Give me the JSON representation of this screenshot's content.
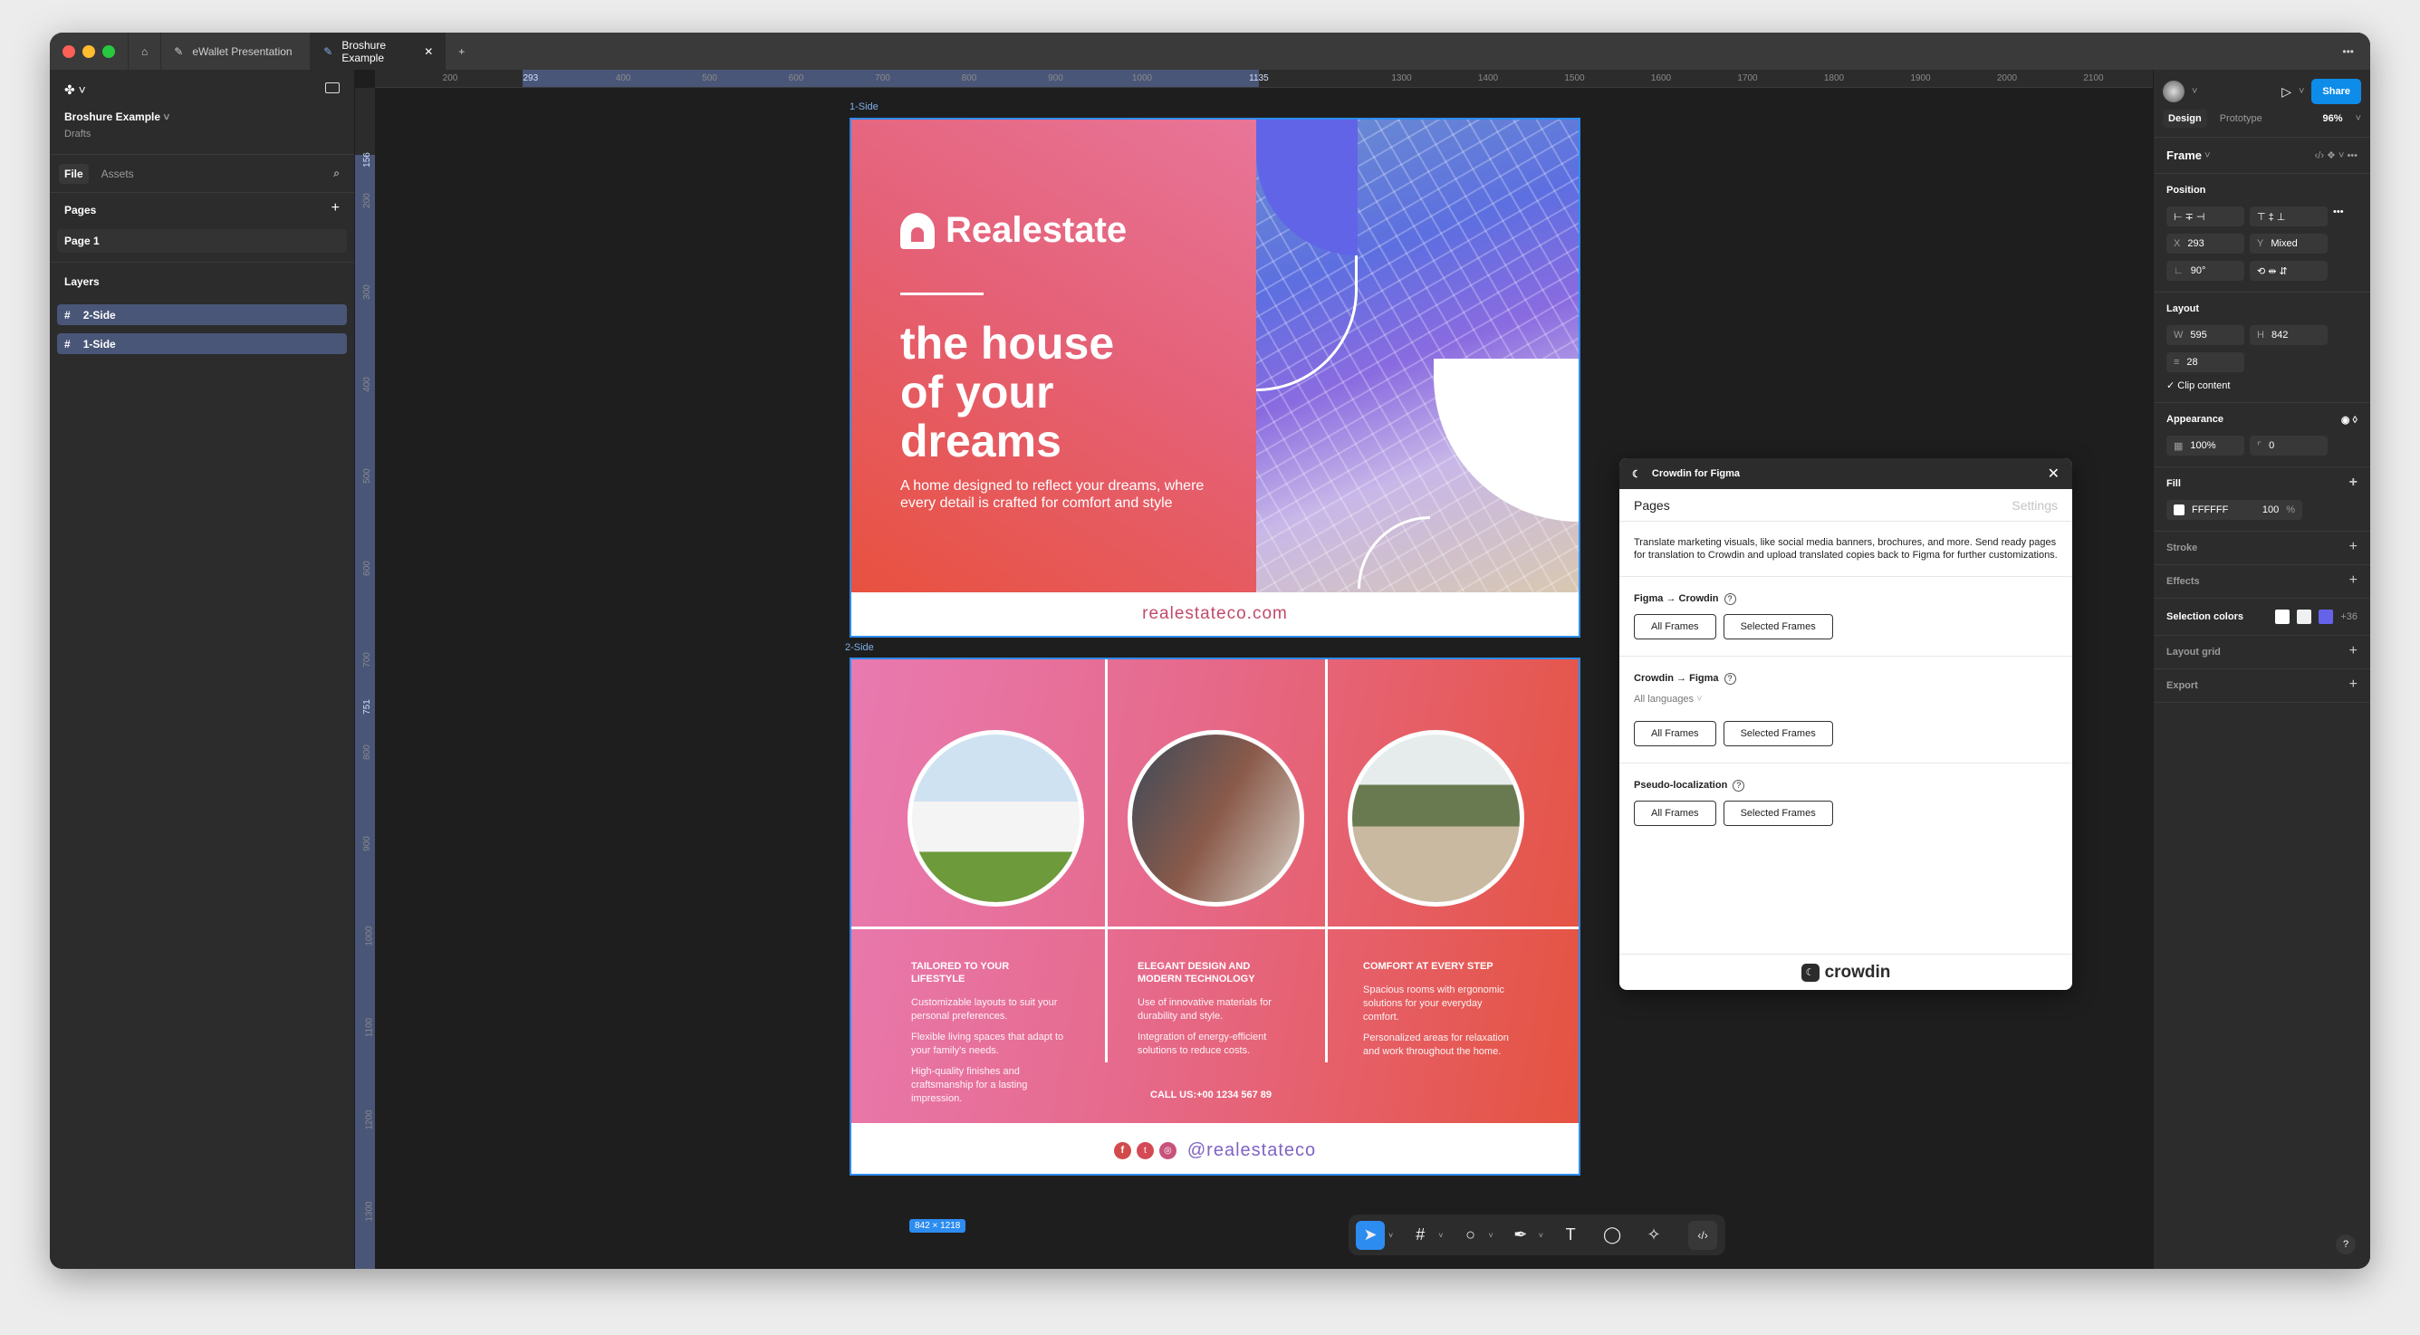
{
  "tabs": [
    {
      "label": "eWallet Presentation"
    },
    {
      "label": "Broshure Example"
    }
  ],
  "left": {
    "file_name": "Broshure Example",
    "location": "Drafts",
    "tab_file": "File",
    "tab_assets": "Assets",
    "pages_title": "Pages",
    "pages": [
      "Page 1"
    ],
    "layers_title": "Layers",
    "layers": [
      "2-Side",
      "1-Side"
    ]
  },
  "rulers": {
    "top": [
      "200",
      "293",
      "400",
      "500",
      "600",
      "700",
      "800",
      "900",
      "1000",
      "1135",
      "1300",
      "1400",
      "1500",
      "1600",
      "1700",
      "1800",
      "1900",
      "2000",
      "2100"
    ],
    "left": [
      "156",
      "200",
      "300",
      "400",
      "500",
      "600",
      "700",
      "751",
      "800",
      "900",
      "1000",
      "1100",
      "1200",
      "1300",
      "1374"
    ]
  },
  "right": {
    "share": "Share",
    "tab_design": "Design",
    "tab_prototype": "Prototype",
    "zoom": "96%",
    "frame": "Frame",
    "position": "Position",
    "x_label": "X",
    "x": "293",
    "y_label": "Y",
    "y": "Mixed",
    "rotation": "90°",
    "layout": "Layout",
    "w_label": "W",
    "w": "595",
    "h_label": "H",
    "h": "842",
    "gap": "28",
    "clip": "Clip content",
    "appearance": "Appearance",
    "opacity": "100%",
    "radius": "0",
    "fill": "Fill",
    "fill_hex": "FFFFFF",
    "fill_opacity": "100",
    "fill_pct": "%",
    "stroke": "Stroke",
    "effects": "Effects",
    "selection_colors": "Selection colors",
    "selection_swatches": [
      "#ffffff",
      "#eef0f2",
      "#6563e8"
    ],
    "selection_more": "+36",
    "layout_grid": "Layout grid",
    "export": "Export"
  },
  "canvas": {
    "frame1_label": "1-Side",
    "frame2_label": "2-Side",
    "size_badge": "842 × 1218"
  },
  "brochure": {
    "brand": "Realestate",
    "headline": [
      "the house",
      "of your",
      "dreams"
    ],
    "subtitle": "A home designed to reflect your dreams, where every detail is crafted for comfort and style",
    "website": "realestateco.com",
    "columns": [
      {
        "title": "TAILORED TO YOUR LIFESTYLE",
        "items": [
          "Customizable layouts to suit your personal preferences.",
          "Flexible living spaces that adapt to your family's needs.",
          "High-quality finishes and craftsmanship for a lasting impression."
        ]
      },
      {
        "title": "ELEGANT DESIGN AND MODERN TECHNOLOGY",
        "items": [
          "Use of innovative materials for durability and style.",
          "Integration of energy-efficient solutions to reduce costs."
        ]
      },
      {
        "title": "COMFORT AT EVERY STEP",
        "items": [
          "Spacious rooms with ergonomic solutions for your everyday comfort.",
          "Personalized areas for relaxation and work throughout the home."
        ]
      }
    ],
    "call": "CALL US:+00 1234 567 89",
    "handle": "@realestateco"
  },
  "plugin": {
    "title": "Crowdin for Figma",
    "tab_pages": "Pages",
    "tab_settings": "Settings",
    "description": "Translate marketing visuals, like social media banners, brochures, and more. Send ready pages for translation to Crowdin and upload translated copies back to Figma for further customizations.",
    "sections": [
      {
        "title": "Figma → Crowdin",
        "all": "All Frames",
        "selected": "Selected Frames"
      },
      {
        "title": "Crowdin → Figma",
        "dropdown": "All languages",
        "all": "All Frames",
        "selected": "Selected Frames"
      },
      {
        "title": "Pseudo-localization",
        "all": "All Frames",
        "selected": "Selected Frames"
      }
    ],
    "footer": "crowdin"
  },
  "help": "?"
}
